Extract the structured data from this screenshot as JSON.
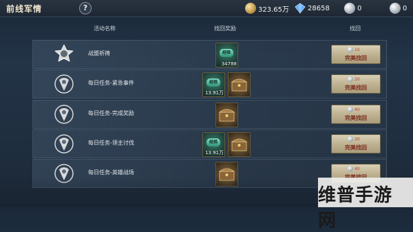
{
  "header": {
    "title": "前线军情",
    "help": "?",
    "resources": [
      {
        "icon": "gold-coin-icon",
        "value": "323.65万"
      },
      {
        "icon": "blue-diamond-icon",
        "value": "28658"
      },
      {
        "icon": "silver-coin-icon",
        "value": "0"
      },
      {
        "icon": "silver-coin-icon",
        "value": "0"
      }
    ]
  },
  "columns": {
    "activity": "活动名称",
    "reward": "找回奖励",
    "retrieve": "找回"
  },
  "rows": [
    {
      "name": "战盟祈祷",
      "rewards": [
        {
          "type": "exp",
          "tag": "经验",
          "qty": "34788"
        }
      ],
      "cost": "10",
      "button": "完美找回"
    },
    {
      "name": "每日任务-紧急事件",
      "rewards": [
        {
          "type": "exp",
          "tag": "经验",
          "qty": "13.91万"
        },
        {
          "type": "chest",
          "qty": ""
        }
      ],
      "cost": "20",
      "button": "完美找回"
    },
    {
      "name": "每日任务-完成奖励",
      "rewards": [
        {
          "type": "chest",
          "qty": ""
        }
      ],
      "cost": "40",
      "button": "完美找回"
    },
    {
      "name": "每日任务-领主讨伐",
      "rewards": [
        {
          "type": "exp",
          "tag": "经验",
          "qty": "13.91万"
        },
        {
          "type": "chest",
          "qty": ""
        }
      ],
      "cost": "20",
      "button": "完美找回"
    },
    {
      "name": "每日任务-英雄战场",
      "rewards": [
        {
          "type": "chest",
          "qty": ""
        }
      ],
      "cost": "40",
      "button": "完美找回"
    }
  ],
  "watermark": "维普手游网",
  "colors": {
    "accent_gold": "#f0e6cf",
    "cost_red": "#c03a22",
    "button_bg": "#bfb393"
  }
}
